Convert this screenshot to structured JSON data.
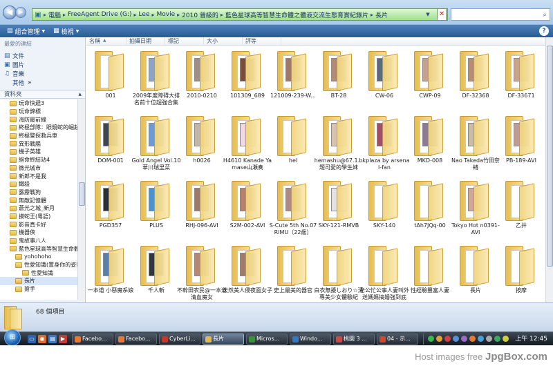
{
  "address": {
    "crumbs": [
      "電腦",
      "FreeAgent Drive (G:)",
      "Lee",
      "Movie",
      "2010 晉級的",
      "藍色星球高等智慧生命體之體液交流生態育實紀錄片",
      "長片"
    ],
    "search_placeholder": ""
  },
  "toolbar": {
    "organize_label": "組合管理",
    "views_label": "檢視"
  },
  "nav": {
    "favorites_header": "最愛的連結",
    "favorites": [
      {
        "label": "文件",
        "icon": "documents-icon"
      },
      {
        "label": "圖片",
        "icon": "pictures-icon"
      },
      {
        "label": "音樂",
        "icon": "music-icon"
      }
    ],
    "more_label": "其他",
    "more_arrow": "»",
    "folders_header": "資料夾",
    "tree": [
      "玩命快遞3",
      "玩命錦標",
      "海防最前線",
      "終極部隊：眼鏡蛇的崛起",
      "終極警探救兵車",
      "異形戰艦",
      "機子英雄",
      "絕命終結站4",
      "微光城市",
      "新郎不是我",
      "鐵殺",
      "露靂戰狗",
      "無敵記憶體",
      "蒼光之城_新月",
      "摸蛇王(粵語)",
      "影音真卡好",
      "機器俠",
      "鬼故事八人",
      "藍色星球高等智慧生命體之",
      "yohohoho",
      "性愛知識(置身你的姿勢)",
      "性愛知識",
      "長片",
      "搶手"
    ],
    "selected_index": 22
  },
  "columns": [
    "名稱",
    "拍攝日期",
    "標記",
    "大小",
    "評等"
  ],
  "files": [
    {
      "label": "001",
      "thumb": ""
    },
    {
      "label": "2009年度障碍大排名前十位超強合集",
      "thumb": "#8fa3c7"
    },
    {
      "label": "2010-0210",
      "thumb": "#9e8f86"
    },
    {
      "label": "101309_689",
      "thumb": "#7a4c3a"
    },
    {
      "label": "121009-239-W...",
      "thumb": "#a0786a"
    },
    {
      "label": "BT-28",
      "thumb": "#b38a73"
    },
    {
      "label": "CW-06",
      "thumb": "#5a6a7a"
    },
    {
      "label": "CWP-09",
      "thumb": "#c5a090"
    },
    {
      "label": "DF-32368",
      "thumb": "#b58e76"
    },
    {
      "label": "DF-33671",
      "thumb": "#c9a28a"
    },
    {
      "label": "DOM-001",
      "thumb": "#3f4650"
    },
    {
      "label": "Gold Angel Vol.10華川瑞里菜",
      "thumb": "#6d9bd1"
    },
    {
      "label": "h0026",
      "thumb": "#c2b5aa"
    },
    {
      "label": "H4610 Kanade Yamase山瀬奏",
      "thumb": "#f0d8e4"
    },
    {
      "label": "hel",
      "thumb": ""
    },
    {
      "label": "hemashu@67.1...題司愛的學生妹",
      "thumb": "#d7c3b0"
    },
    {
      "label": "hkplaza by arsenal-fan",
      "thumb": "#a04e64"
    },
    {
      "label": "MKD-008",
      "thumb": "#8c7a92"
    },
    {
      "label": "Nao Takeda竹田奈緒",
      "thumb": "#c7bca5"
    },
    {
      "label": "PB-189-AVI",
      "thumb": "#bf9b95"
    },
    {
      "label": "PGD357",
      "thumb": "#2b2f36"
    },
    {
      "label": "PLUS",
      "thumb": "#4c92cf"
    },
    {
      "label": "RHJ-096-AVI",
      "thumb": "#9c7a69"
    },
    {
      "label": "S2M-002-AVI",
      "thumb": "#b7806a"
    },
    {
      "label": "S-Cute 5th No.07 RIMU（22歳）",
      "thumb": "#b08a80"
    },
    {
      "label": "SKY-121-RMVB",
      "thumb": "#e6e0de"
    },
    {
      "label": "SKY-140",
      "thumb": ""
    },
    {
      "label": "tAh7JQq-00",
      "thumb": ""
    },
    {
      "label": "Tokyo Hot n0391-AVI",
      "thumb": "#d0a894"
    },
    {
      "label": "乙井",
      "thumb": ""
    },
    {
      "label": "一本道 小惡魔系娘",
      "thumb": "#5b7fa8"
    },
    {
      "label": "千人斬",
      "thumb": "#30373f"
    },
    {
      "label": "不幹田农民@一本道 清血魔女",
      "thumb": "#b48872"
    },
    {
      "label": "天然美人侵夜面女子",
      "thumb": "#9f7b6a"
    },
    {
      "label": "史上最美的器官",
      "thumb": ""
    },
    {
      "label": "白衣無擾しおり☆淸專美少女體驗紀",
      "thumb": ""
    },
    {
      "label": "老公忙公事人妻叫外送媽媽搞婚強到底",
      "thumb": ""
    },
    {
      "label": "性經驗豐富人妻",
      "thumb": ""
    },
    {
      "label": "長片",
      "thumb": ""
    },
    {
      "label": "按摩",
      "thumb": ""
    }
  ],
  "details": {
    "count_text": "68 個項目"
  },
  "taskbar": {
    "tasks": [
      {
        "label": "Facebo...",
        "color": "#e8783a"
      },
      {
        "label": "Facebo...",
        "color": "#e8783a"
      },
      {
        "label": "CyberLi...",
        "color": "#c0392b"
      },
      {
        "label": "長片",
        "color": "#e3b94c"
      },
      {
        "label": "Micros...",
        "color": "#3b8f3b"
      },
      {
        "label": "Windo...",
        "color": "#3477c5"
      },
      {
        "label": "桃園 3 ...",
        "color": "#c94a4a"
      },
      {
        "label": "04 - 示...",
        "color": "#d04a2a"
      }
    ],
    "active_index": 3,
    "clock": "上午 12:45"
  },
  "watermark": {
    "prefix": "Host images free",
    "brand": "JpgBox.com"
  }
}
